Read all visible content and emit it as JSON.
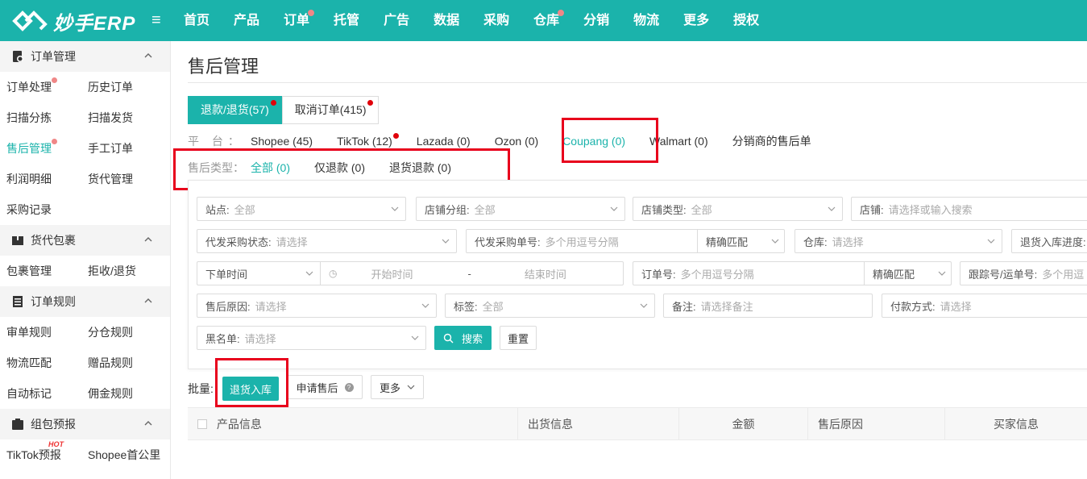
{
  "app": {
    "title": "妙手ERP",
    "menu_icon": "hamburger-icon",
    "accent_color": "#1bb3ab"
  },
  "nav": [
    {
      "label": "首页",
      "dot": false
    },
    {
      "label": "产品",
      "dot": false
    },
    {
      "label": "订单",
      "dot": true
    },
    {
      "label": "托管",
      "dot": false
    },
    {
      "label": "广告",
      "dot": false
    },
    {
      "label": "数据",
      "dot": false
    },
    {
      "label": "采购",
      "dot": false
    },
    {
      "label": "仓库",
      "dot": true
    },
    {
      "label": "分销",
      "dot": false
    },
    {
      "label": "物流",
      "dot": false
    },
    {
      "label": "更多",
      "dot": false
    },
    {
      "label": "授权",
      "dot": false
    }
  ],
  "sidebar": {
    "groups": [
      {
        "title": "订单管理",
        "icon": "order-settings-icon",
        "items": [
          "订单处理",
          "历史订单",
          "扫描分拣",
          "扫描发货",
          "售后管理",
          "手工订单",
          "利润明细",
          "货代管理",
          "采购记录"
        ]
      },
      {
        "title": "货代包裹",
        "icon": "package-icon",
        "items": [
          "包裹管理",
          "拒收/退货"
        ]
      },
      {
        "title": "订单规则",
        "icon": "rules-list-icon",
        "items": [
          "审单规则",
          "分仓规则",
          "物流匹配",
          "赠品规则",
          "自动标记",
          "佣金规则"
        ]
      },
      {
        "title": "组包预报",
        "icon": "bundle-icon",
        "items": [
          "TikTok预报",
          "Shopee首公里"
        ],
        "hot_label": "HOT"
      }
    ],
    "active_item": "售后管理"
  },
  "main": {
    "title": "售后管理",
    "tabs": [
      {
        "label": "退款/退货(57)",
        "active": true
      },
      {
        "label": "取消订单(415)",
        "active": false
      }
    ],
    "platform": {
      "label": "平 台：",
      "items": [
        "Shopee (45)",
        "TikTok (12)",
        "Lazada (0)",
        "Ozon (0)",
        "Coupang (0)",
        "Walmart (0)",
        "分销商的售后单"
      ],
      "selected": "Coupang (0)"
    },
    "aftersale_type": {
      "label": "售后类型：",
      "items": [
        "全部 (0)",
        "仅退款 (0)",
        "退货退款 (0)"
      ],
      "selected": "全部 (0)"
    },
    "filters": {
      "site": {
        "label": "站点:",
        "value": "全部"
      },
      "shop_group": {
        "label": "店铺分组:",
        "value": "全部"
      },
      "shop_type": {
        "label": "店铺类型:",
        "value": "全部"
      },
      "shop": {
        "label": "店铺:",
        "placeholder": "请选择或输入搜索"
      },
      "proxy_status": {
        "label": "代发采购状态:",
        "placeholder": "请选择"
      },
      "proxy_no": {
        "label": "代发采购单号:",
        "placeholder": "多个用逗号分隔",
        "match": "精确匹配"
      },
      "warehouse": {
        "label": "仓库:",
        "placeholder": "请选择"
      },
      "return_progress": {
        "label": "退货入库进度:"
      },
      "time_type": "下单时间",
      "start_time": "开始时间",
      "time_sep": "-",
      "end_time": "结束时间",
      "order_no": {
        "label": "订单号:",
        "placeholder": "多个用逗号分隔",
        "match": "精确匹配"
      },
      "tracking_no": {
        "label": "跟踪号/运单号:",
        "placeholder": "多个用逗"
      },
      "reason": {
        "label": "售后原因:",
        "placeholder": "请选择"
      },
      "tag": {
        "label": "标签:",
        "value": "全部"
      },
      "remark": {
        "label": "备注:",
        "placeholder": "请选择备注"
      },
      "payment": {
        "label": "付款方式:",
        "placeholder": "请选择"
      },
      "blacklist": {
        "label": "黑名单:",
        "placeholder": "请选择"
      },
      "search_button": "搜索",
      "reset_button": "重置"
    },
    "batch": {
      "label": "批量:",
      "return_in": "退货入库",
      "apply_aftersale": "申请售后",
      "more": "更多"
    },
    "table": {
      "headers": [
        "产品信息",
        "出货信息",
        "金额",
        "售后原因",
        "买家信息"
      ]
    }
  }
}
